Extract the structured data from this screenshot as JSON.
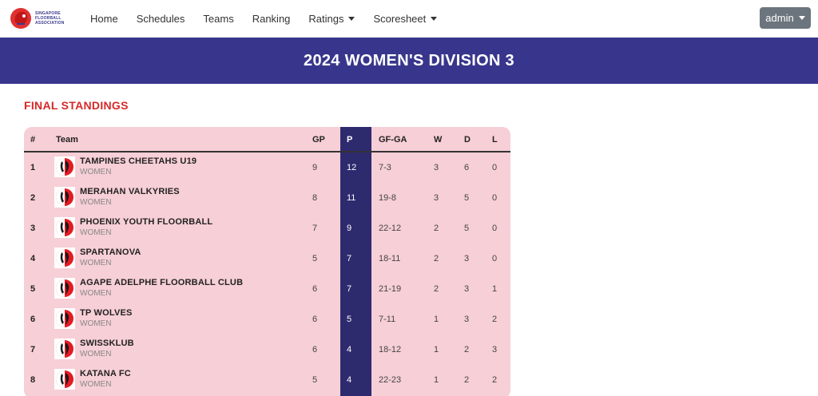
{
  "nav": {
    "logo_text": [
      "SINGAPORE",
      "FLOORBALL",
      "ASSOCIATION"
    ],
    "items": [
      {
        "label": "Home",
        "dropdown": false
      },
      {
        "label": "Schedules",
        "dropdown": false
      },
      {
        "label": "Teams",
        "dropdown": false
      },
      {
        "label": "Ranking",
        "dropdown": false
      },
      {
        "label": "Ratings",
        "dropdown": true
      },
      {
        "label": "Scoresheet",
        "dropdown": true
      }
    ],
    "user_button": "admin"
  },
  "banner": {
    "title": "2024 WOMEN'S DIVISION 3"
  },
  "section_title": "FINAL STANDINGS",
  "table": {
    "headers": [
      "#",
      "Team",
      "GP",
      "P",
      "GF-GA",
      "W",
      "D",
      "L"
    ],
    "rows": [
      {
        "rank": "1",
        "team": "TAMPINES CHEETAHS U19",
        "category": "WOMEN",
        "gp": "9",
        "p": "12",
        "gfga": "7-3",
        "w": "3",
        "d": "6",
        "l": "0"
      },
      {
        "rank": "2",
        "team": "MERAHAN VALKYRIES",
        "category": "WOMEN",
        "gp": "8",
        "p": "11",
        "gfga": "19-8",
        "w": "3",
        "d": "5",
        "l": "0"
      },
      {
        "rank": "3",
        "team": "PHOENIX YOUTH FLOORBALL",
        "category": "WOMEN",
        "gp": "7",
        "p": "9",
        "gfga": "22-12",
        "w": "2",
        "d": "5",
        "l": "0"
      },
      {
        "rank": "4",
        "team": "SPARTANOVA",
        "category": "WOMEN",
        "gp": "5",
        "p": "7",
        "gfga": "18-11",
        "w": "2",
        "d": "3",
        "l": "0"
      },
      {
        "rank": "5",
        "team": "AGAPE ADELPHE FLOORBALL CLUB",
        "category": "WOMEN",
        "gp": "6",
        "p": "7",
        "gfga": "21-19",
        "w": "2",
        "d": "3",
        "l": "1"
      },
      {
        "rank": "6",
        "team": "TP WOLVES",
        "category": "WOMEN",
        "gp": "6",
        "p": "5",
        "gfga": "7-11",
        "w": "1",
        "d": "3",
        "l": "2"
      },
      {
        "rank": "7",
        "team": "SWISSKLUB",
        "category": "WOMEN",
        "gp": "6",
        "p": "4",
        "gfga": "18-12",
        "w": "1",
        "d": "2",
        "l": "3"
      },
      {
        "rank": "8",
        "team": "KATANA FC",
        "category": "WOMEN",
        "gp": "5",
        "p": "4",
        "gfga": "22-23",
        "w": "1",
        "d": "2",
        "l": "2"
      }
    ]
  },
  "colors": {
    "banner": "#38368c",
    "accent_red": "#d62828",
    "table_bg": "#f7cfd6",
    "points_col": "#2e2a6e",
    "admin_btn": "#6c757d"
  }
}
